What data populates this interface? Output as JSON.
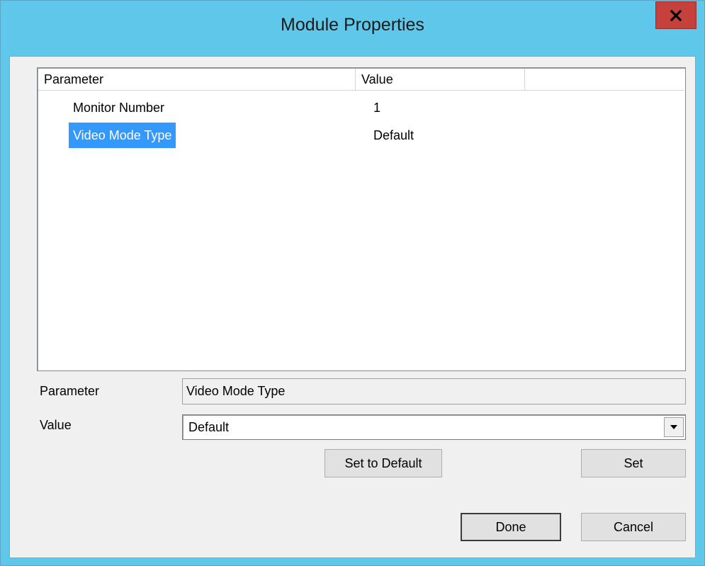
{
  "window": {
    "title": "Module Properties"
  },
  "listview": {
    "columns": [
      "Parameter",
      "Value",
      ""
    ],
    "rows": [
      {
        "parameter": "Monitor Number",
        "value": "1"
      },
      {
        "parameter": "Video Mode Type",
        "value": "Default",
        "selected": true
      }
    ]
  },
  "editor": {
    "parameter_label": "Parameter",
    "parameter_value": "Video Mode Type",
    "value_label": "Value",
    "value_selected": "Default"
  },
  "buttons": {
    "set_to_default": "Set to Default",
    "set": "Set",
    "done": "Done",
    "cancel": "Cancel"
  },
  "icons": {
    "close": "close-icon",
    "dropdown": "chevron-down-icon"
  },
  "colors": {
    "titlebar": "#5fc7ea",
    "close": "#c6413b",
    "selection": "#3399ff"
  }
}
